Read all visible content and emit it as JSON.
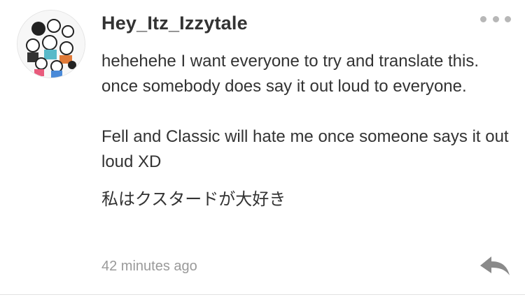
{
  "comment": {
    "username": "Hey_Itz_Izzytale",
    "paragraphs": [
      "hehehehe I want everyone to try and translate this. once somebody does say it out loud to everyone.",
      "Fell and Classic will hate me once someone says it out loud XD",
      "私はクスタードが大好き"
    ],
    "timestamp": "42 minutes ago"
  },
  "icons": {
    "avatar": "user-avatar-drawing",
    "more": "more-dots-icon",
    "reply": "reply-arrow-icon"
  },
  "colors": {
    "text": "#333333",
    "muted": "#9a9a9a",
    "icon": "#b7b7b7",
    "reply_icon": "#8a8a8a"
  }
}
